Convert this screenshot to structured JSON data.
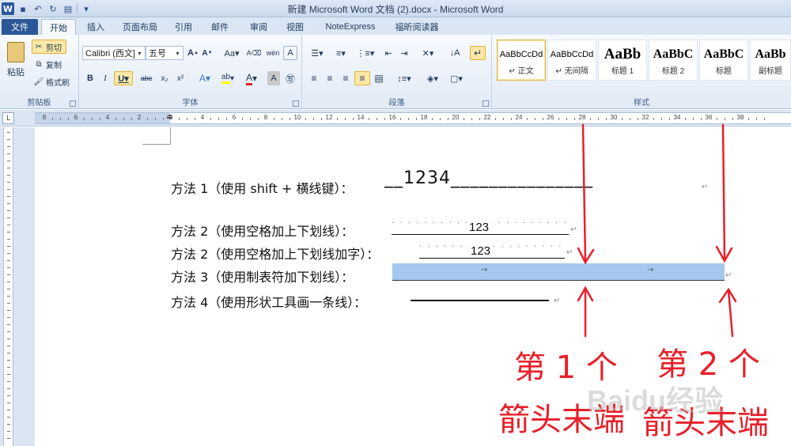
{
  "window": {
    "title": "新建 Microsoft Word 文档 (2).docx - Microsoft Word"
  },
  "tabs": [
    "文件",
    "开始",
    "插入",
    "页面布局",
    "引用",
    "邮件",
    "审阅",
    "视图",
    "NoteExpress",
    "福昕阅读器"
  ],
  "clipboard": {
    "paste": "粘贴",
    "cut": "剪切",
    "copy": "复制",
    "format_painter": "格式刷",
    "label": "剪贴板"
  },
  "font": {
    "name": "Calibri (西文]",
    "size": "五号",
    "label": "字体"
  },
  "paragraph": {
    "label": "段落"
  },
  "styles": {
    "label": "样式",
    "items": [
      {
        "preview": "AaBbCcDd",
        "name": "↵ 正文"
      },
      {
        "preview": "AaBbCcDd",
        "name": "↵ 无间隔"
      },
      {
        "preview": "AaBb",
        "name": "标题 1"
      },
      {
        "preview": "AaBbC",
        "name": "标题 2"
      },
      {
        "preview": "AaBbC",
        "name": "标题"
      },
      {
        "preview": "AaBb",
        "name": "副标题"
      }
    ]
  },
  "ruler": {
    "numbers": [
      "8",
      "6",
      "4",
      "2",
      "2",
      "4",
      "6",
      "8",
      "10",
      "12",
      "14",
      "16",
      "18",
      "20",
      "22",
      "24",
      "26",
      "28",
      "30",
      "32",
      "34",
      "36",
      "38"
    ]
  },
  "document": {
    "line1": {
      "text": "方法 1（使用 shift + 横线键）：",
      "handwritten": "__1234_______________"
    },
    "line2": {
      "text": "方法 2（使用空格加上下划线）：",
      "value": "123"
    },
    "line3": {
      "text": "方法 2（使用空格加上下划线加字）：",
      "value": "123"
    },
    "line4": {
      "text": "方法 3（使用制表符加下划线）：",
      "tab_mark": "→"
    },
    "line5": {
      "text": "方法 4（使用形状工具画一条线）："
    }
  },
  "annotations": {
    "first": "第 1 个 箭头末端",
    "second": "第 2 个 箭头末端",
    "watermark": "Baidu经验"
  },
  "colors": {
    "annotation": "#e8202a",
    "highlight": "#a6c8ef",
    "file_tab": "#2b5797"
  }
}
